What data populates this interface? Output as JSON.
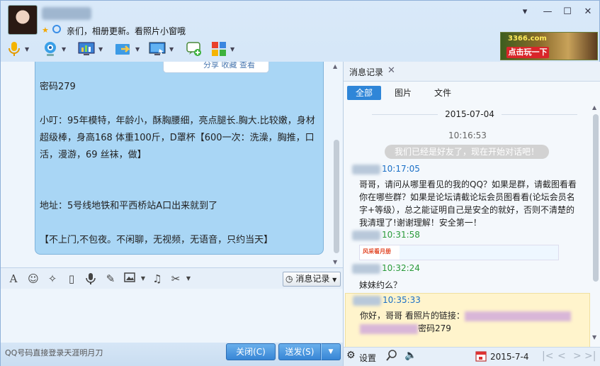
{
  "header": {
    "signature": "亲们，相册更新。看照片小窗哦",
    "window_controls": [
      "▾",
      "—",
      "☐",
      "✕"
    ],
    "toolbar_icons": [
      "microphone-icon",
      "camera-icon",
      "screen-share-icon",
      "file-transfer-icon",
      "remote-desktop-icon",
      "add-app-icon",
      "apps-grid-icon"
    ],
    "ad": {
      "logo": "3366.com",
      "button": "点击玩一下"
    }
  },
  "chat": {
    "bubble_actions": "分享  收藏  查看",
    "bubble_text": "密码279\n\n小叮：95年模特，年龄小，酥胸腰细，亮点腿长.胸大.比较嫩，身材超级棒，身高168 体重100斤，D罩杯【600一次：洗澡，胸推，口活，漫游，69 丝袜，做】\n\n\n地址：5号线地铁和平西桥站A口出来就到了\n\n【不上门,不包夜。不闲聊，无视频，无语音，只约当天】"
  },
  "input_toolbar": {
    "icons": [
      "font-icon",
      "emoji-icon",
      "magic-icon",
      "shake-icon",
      "voice-icon",
      "edit-icon",
      "image-icon",
      "music-icon",
      "screenshot-icon"
    ],
    "history_button": "消息记录"
  },
  "bottom": {
    "ad_text": "QQ号码直接登录天涯明月刀",
    "close_label": "关闭(C)",
    "send_label": "送发(S)"
  },
  "history": {
    "tab_label": "消息记录",
    "filters": [
      "全部",
      "图片",
      "文件"
    ],
    "date": "2015-07-04",
    "system_time": "10:16:53",
    "system_message": "我们已经是好友了，现在开始对话吧！",
    "messages": [
      {
        "time": "10:17:05",
        "body": "哥哥，请问从哪里看见的我的QQ？如果是群，请截图看看你在哪些群？如果是论坛请截论坛会员图看看(论坛会员名字+等级），总之能证明自己是安全的就好，否则不清楚的我清理了!谢谢理解！安全第一！"
      },
      {
        "time": "10:31:58",
        "body": ""
      },
      {
        "time": "10:32:24",
        "body": "妹妹约么？"
      },
      {
        "time": "10:35:33",
        "body_prefix": "你好，哥哥 看照片的链接：",
        "body_suffix": "密码279"
      }
    ],
    "image_logo": "风采看月册",
    "settings_label": "设置",
    "bottom_date": "2015-7-4"
  }
}
